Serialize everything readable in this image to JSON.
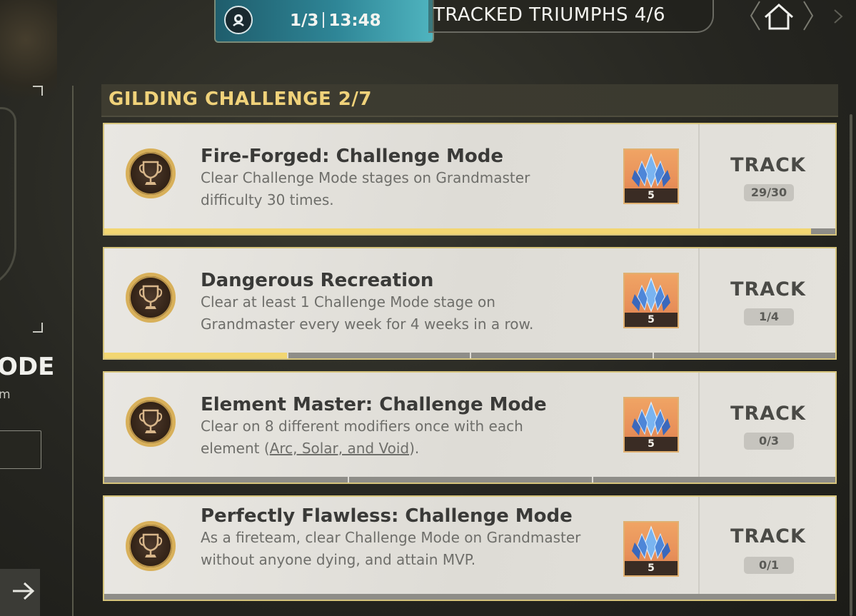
{
  "header": {
    "activity_progress": "1/3",
    "timer": "13:48",
    "tracked_label": "TRACKED TRIUMPHS 4/6"
  },
  "left_panel": {
    "title_fragment": "ODE",
    "subtitle_fragment": "m"
  },
  "section": {
    "title": "GILDING CHALLENGE 2/7"
  },
  "challenges": [
    {
      "title": "Fire-Forged: Challenge Mode",
      "desc_before": "Clear Challenge Mode stages on Grandmaster difficulty 30 times.",
      "desc_link": "",
      "desc_after": "",
      "reward_count": "5",
      "track_label": "TRACK",
      "progress_text": "29/30",
      "progress_fraction": 0.967
    },
    {
      "title": "Dangerous Recreation",
      "desc_before": "Clear at least 1 Challenge Mode stage on Grandmaster every week for 4 weeks in a row.",
      "desc_link": "",
      "desc_after": "",
      "reward_count": "5",
      "track_label": "TRACK",
      "progress_text": "1/4",
      "progress_fraction": 0.25
    },
    {
      "title": "Element Master: Challenge Mode",
      "desc_before": "Clear on 8 different modifiers once with each element (",
      "desc_link": "Arc, Solar, and Void",
      "desc_after": ").",
      "reward_count": "5",
      "track_label": "TRACK",
      "progress_text": "0/3",
      "progress_fraction": 0
    },
    {
      "title": "Perfectly Flawless: Challenge Mode",
      "desc_before": "As a fireteam, clear Challenge Mode on Grandmaster without anyone dying, and attain MVP.",
      "desc_link": "",
      "desc_after": "",
      "reward_count": "5",
      "track_label": "TRACK",
      "progress_text": "0/1",
      "progress_fraction": 0
    }
  ],
  "colors": {
    "section_title": "#f0d27a",
    "progress_fill": "#f2d672",
    "timer_accent": "#2e8596",
    "reward_bg": "#e8905a"
  }
}
